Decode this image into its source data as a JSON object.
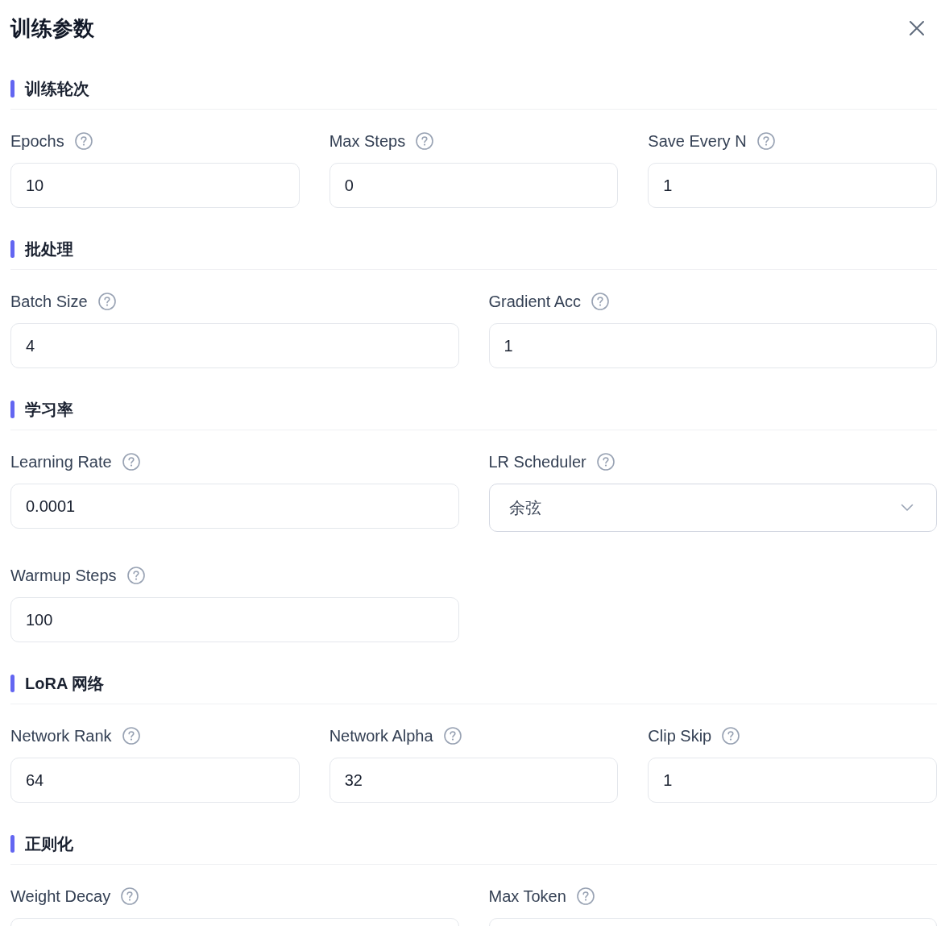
{
  "dialog": {
    "title": "训练参数"
  },
  "sections": [
    {
      "title": "训练轮次",
      "rows": [
        [
          {
            "label": "Epochs",
            "kind": "input",
            "value": "10"
          },
          {
            "label": "Max Steps",
            "kind": "input",
            "value": "0"
          },
          {
            "label": "Save Every N",
            "kind": "input",
            "value": "1"
          }
        ]
      ]
    },
    {
      "title": "批处理",
      "rows": [
        [
          {
            "label": "Batch Size",
            "kind": "input",
            "value": "4"
          },
          {
            "label": "Gradient Acc",
            "kind": "input",
            "value": "1"
          }
        ]
      ]
    },
    {
      "title": "学习率",
      "rows": [
        [
          {
            "label": "Learning Rate",
            "kind": "input",
            "value": "0.0001"
          },
          {
            "label": "LR Scheduler",
            "kind": "select",
            "value": "余弦"
          }
        ],
        [
          {
            "label": "Warmup Steps",
            "kind": "input",
            "value": "100"
          }
        ]
      ]
    },
    {
      "title": "LoRA 网络",
      "rows": [
        [
          {
            "label": "Network Rank",
            "kind": "input",
            "value": "64"
          },
          {
            "label": "Network Alpha",
            "kind": "input",
            "value": "32"
          },
          {
            "label": "Clip Skip",
            "kind": "input",
            "value": "1"
          }
        ]
      ]
    },
    {
      "title": "正则化",
      "rows": [
        [
          {
            "label": "Weight Decay",
            "kind": "input"
          },
          {
            "label": "Max Token",
            "kind": "input"
          }
        ]
      ]
    }
  ]
}
